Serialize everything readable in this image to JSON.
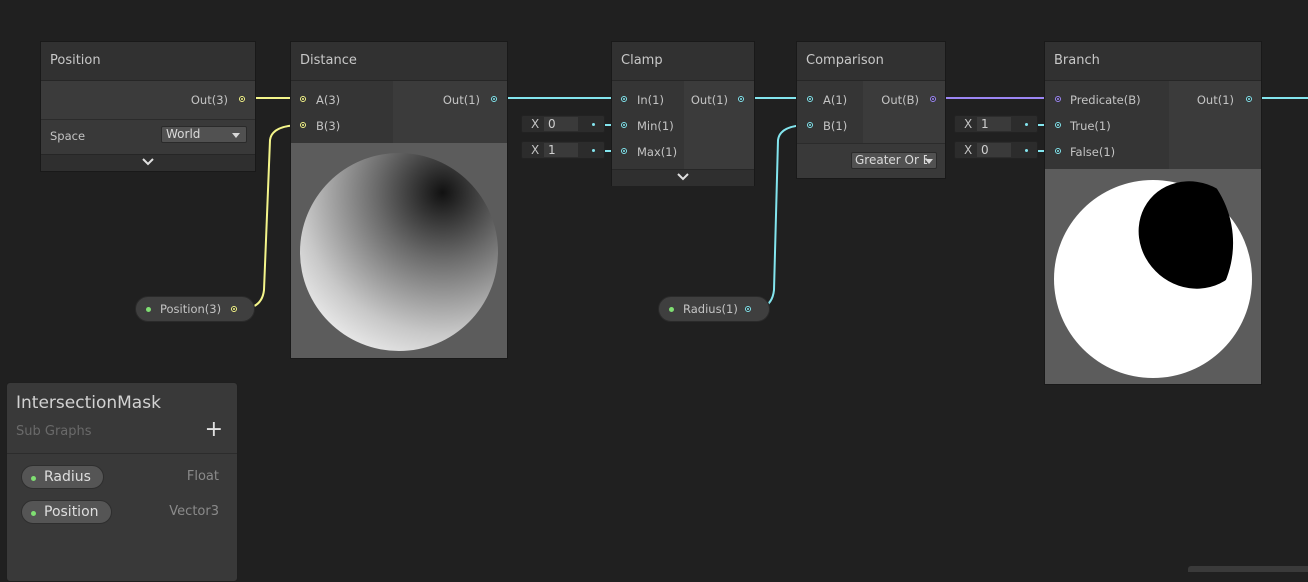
{
  "nodes": {
    "position": {
      "title": "Position",
      "out_label": "Out(3)",
      "space_label": "Space",
      "space_value": "World"
    },
    "distance": {
      "title": "Distance",
      "in_a": "A(3)",
      "in_b": "B(3)",
      "out_label": "Out(1)"
    },
    "clamp": {
      "title": "Clamp",
      "in_in": "In(1)",
      "in_min": "Min(1)",
      "in_max": "Max(1)",
      "out_label": "Out(1)"
    },
    "comparison": {
      "title": "Comparison",
      "in_a": "A(1)",
      "in_b": "B(1)",
      "out_label": "Out(B)",
      "mode_value": "Greater Or E"
    },
    "branch": {
      "title": "Branch",
      "in_pred": "Predicate(B)",
      "in_true": "True(1)",
      "in_false": "False(1)",
      "out_label": "Out(1)"
    }
  },
  "inline_fields": {
    "clamp_min": {
      "axis": "X",
      "value": "0"
    },
    "clamp_max": {
      "axis": "X",
      "value": "1"
    },
    "branch_true": {
      "axis": "X",
      "value": "1"
    },
    "branch_false": {
      "axis": "X",
      "value": "0"
    }
  },
  "property_nodes": {
    "position": {
      "label": "Position(3)"
    },
    "radius": {
      "label": "Radius(1)"
    }
  },
  "blackboard": {
    "title": "IntersectionMask",
    "subtitle": "Sub Graphs",
    "add_label": "+",
    "properties": [
      {
        "name": "Radius",
        "type": "Float"
      },
      {
        "name": "Position",
        "type": "Vector3"
      }
    ]
  },
  "colors": {
    "vector3_wire": "#f4f58a",
    "vector1_wire": "#83e5ee",
    "boolean_wire": "#9c86f5",
    "property_dot": "#7fdf72"
  },
  "icons": {
    "expand": "chevron-down-icon",
    "dropdown": "triangle-down-icon",
    "add": "plus-icon"
  }
}
